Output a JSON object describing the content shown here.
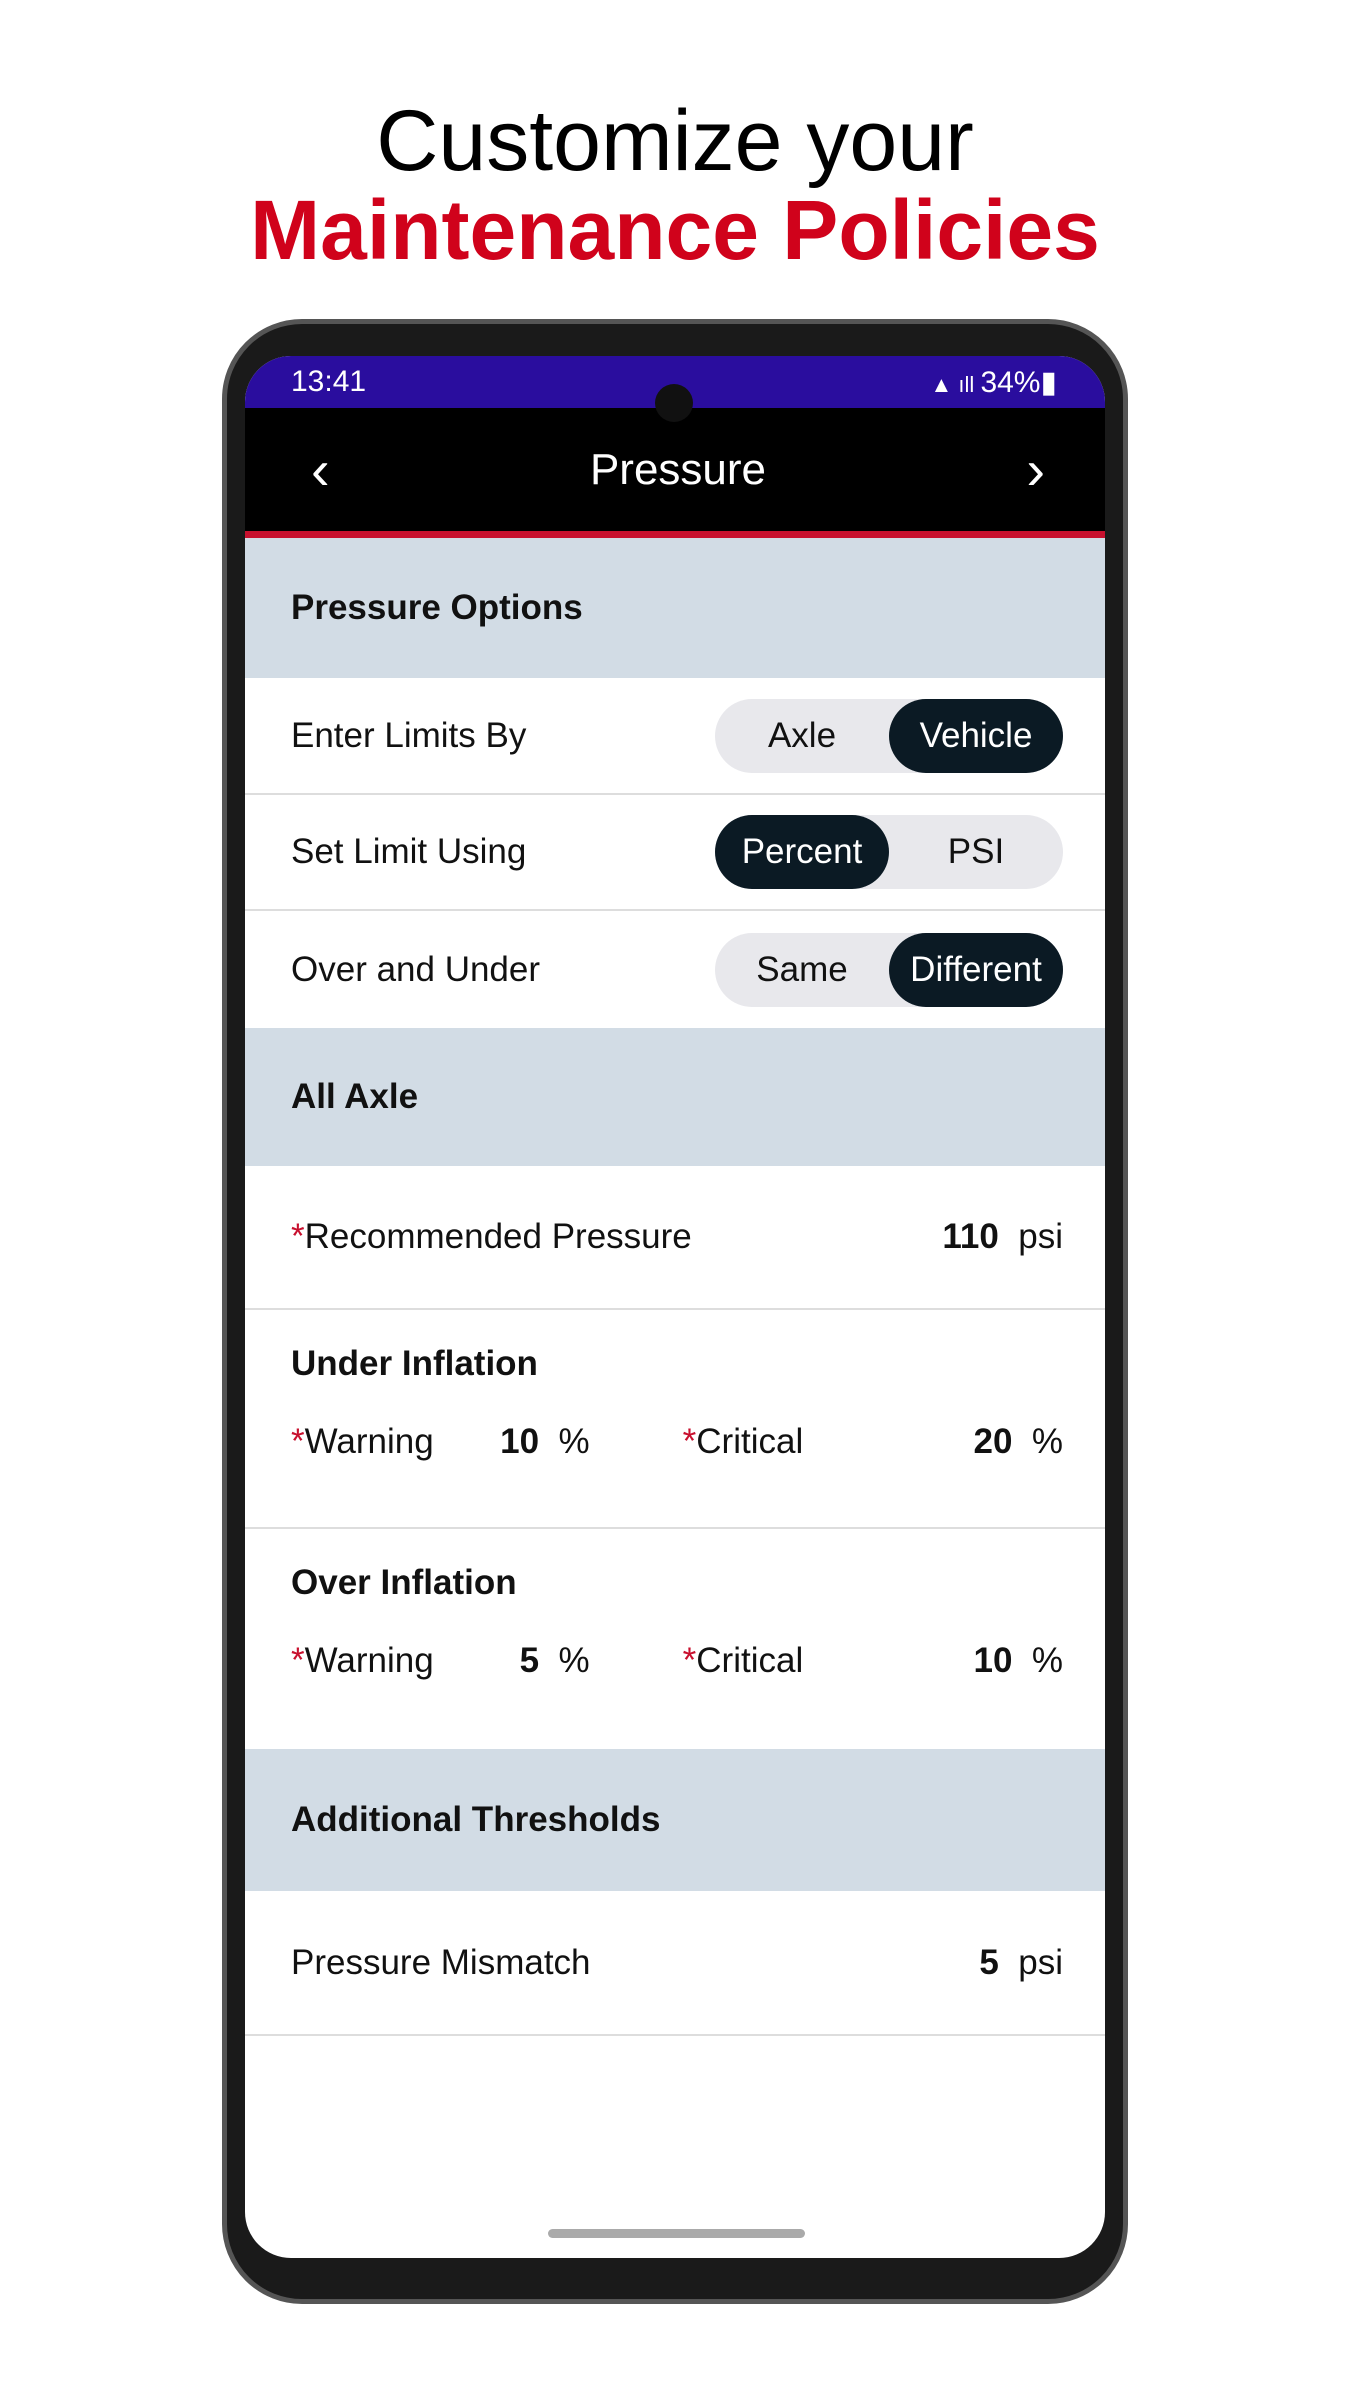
{
  "promo": {
    "line1": "Customize your",
    "line2": "Maintenance Policies"
  },
  "status": {
    "time": "13:41",
    "right": "34%",
    "icons": [
      "battery-saver-icon",
      "wifi-icon",
      "volte-icon",
      "signal-icon",
      "battery-icon"
    ]
  },
  "header": {
    "title": "Pressure",
    "back_icon": "chevron-left-icon",
    "next_icon": "chevron-right-icon"
  },
  "options": {
    "title": "Pressure Options",
    "rows": [
      {
        "label": "Enter Limits By",
        "options": [
          "Axle",
          "Vehicle"
        ],
        "selected": "Vehicle"
      },
      {
        "label": "Set Limit Using",
        "options": [
          "Percent",
          "PSI"
        ],
        "selected": "Percent"
      },
      {
        "label": "Over and Under",
        "options": [
          "Same",
          "Different"
        ],
        "selected": "Different"
      }
    ]
  },
  "axle": {
    "title": "All Axle",
    "recommended": {
      "label": "Recommended Pressure",
      "value": "110",
      "unit": "psi"
    },
    "under": {
      "title": "Under Inflation",
      "warning_label": "Warning",
      "warning": "10",
      "warning_unit": "%",
      "critical_label": "Critical",
      "critical": "20",
      "critical_unit": "%"
    },
    "over": {
      "title": "Over Inflation",
      "warning_label": "Warning",
      "warning": "5",
      "warning_unit": "%",
      "critical_label": "Critical",
      "critical": "10",
      "critical_unit": "%"
    }
  },
  "additional": {
    "title": "Additional Thresholds",
    "mismatch": {
      "label": "Pressure Mismatch",
      "value": "5",
      "unit": "psi"
    }
  },
  "required_mark": "*",
  "colors": {
    "accent": "#d0021b",
    "status_bar": "#2a0d9e",
    "section": "#d2dce5",
    "segment_on": "#0b1a24"
  }
}
